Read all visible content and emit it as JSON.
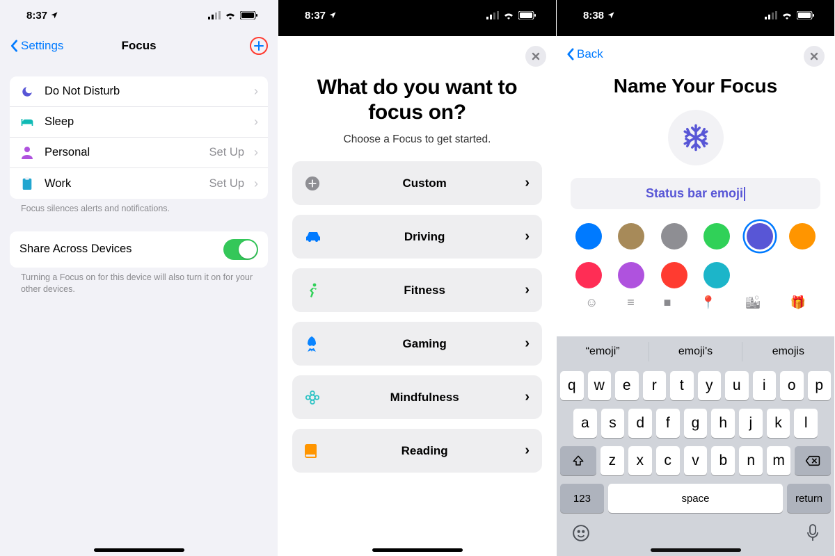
{
  "phone1": {
    "time": "8:37",
    "nav": {
      "back": "Settings",
      "title": "Focus"
    },
    "modes": [
      {
        "icon": "moon",
        "color": "#5856d6",
        "label": "Do Not Disturb",
        "detail": ""
      },
      {
        "icon": "bed",
        "color": "#0fbab5",
        "label": "Sleep",
        "detail": ""
      },
      {
        "icon": "person",
        "color": "#af52de",
        "label": "Personal",
        "detail": "Set Up"
      },
      {
        "icon": "badge",
        "color": "#22a6d0",
        "label": "Work",
        "detail": "Set Up"
      }
    ],
    "modes_footer": "Focus silences alerts and notifications.",
    "share": {
      "label": "Share Across Devices"
    },
    "share_footer": "Turning a Focus on for this device will also turn it on for your other devices."
  },
  "phone2": {
    "time": "8:37",
    "title": "What do you want to focus on?",
    "subtitle": "Choose a Focus to get started.",
    "options": [
      {
        "icon": "plus",
        "color": "#8e8e93",
        "label": "Custom"
      },
      {
        "icon": "car",
        "color": "#007aff",
        "label": "Driving"
      },
      {
        "icon": "runner",
        "color": "#30d158",
        "label": "Fitness"
      },
      {
        "icon": "rocket",
        "color": "#0a84ff",
        "label": "Gaming"
      },
      {
        "icon": "lotus",
        "color": "#2bc2c4",
        "label": "Mindfulness"
      },
      {
        "icon": "book",
        "color": "#ff9500",
        "label": "Reading"
      }
    ]
  },
  "phone3": {
    "time": "8:38",
    "back": "Back",
    "title": "Name Your Focus",
    "input_value": "Status bar emoji",
    "colors": [
      "#007aff",
      "#a78a59",
      "#8e8e93",
      "#30d158",
      "#5856d6",
      "#ff9500",
      "#ff2d55",
      "#af52de",
      "#ff3b30",
      "#1cb5c9"
    ],
    "selected_color_index": 4,
    "glyphs": [
      "☺",
      "≡",
      "■",
      "📍",
      "🏙",
      "🎁"
    ],
    "suggestions": [
      "“emoji”",
      "emoji's",
      "emojis"
    ],
    "keys": {
      "r1": [
        "q",
        "w",
        "e",
        "r",
        "t",
        "y",
        "u",
        "i",
        "o",
        "p"
      ],
      "r2": [
        "a",
        "s",
        "d",
        "f",
        "g",
        "h",
        "j",
        "k",
        "l"
      ],
      "r3": [
        "z",
        "x",
        "c",
        "v",
        "b",
        "n",
        "m"
      ],
      "numKey": "123",
      "space": "space",
      "return": "return"
    }
  }
}
